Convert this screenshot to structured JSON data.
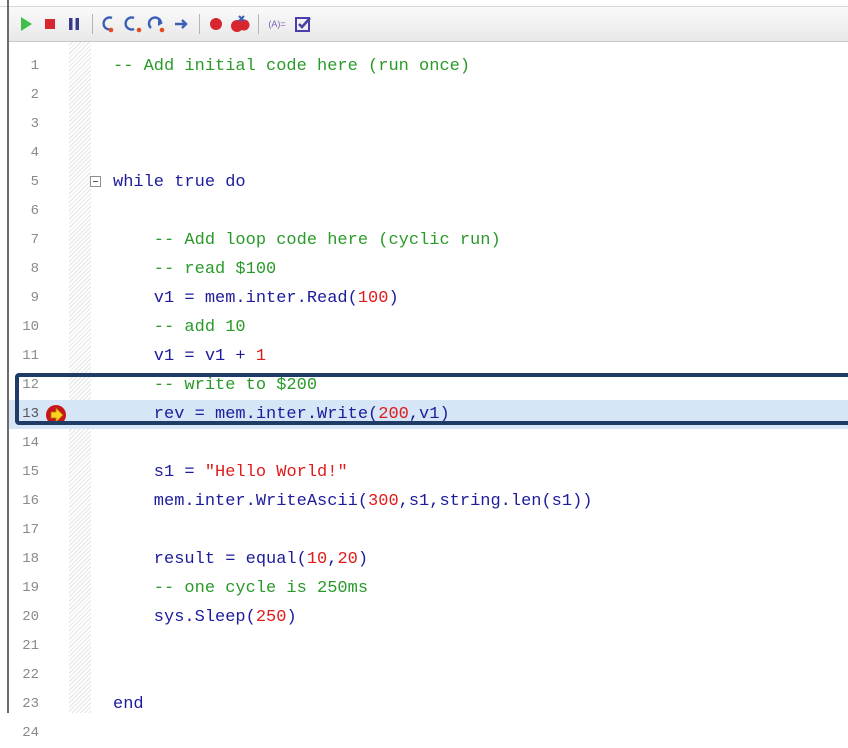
{
  "toolbar": {
    "buttons": [
      {
        "name": "run-button",
        "icon": "play-icon",
        "color": "#3fbf4a"
      },
      {
        "name": "stop-button",
        "icon": "stop-icon",
        "color": "#d7262d"
      },
      {
        "name": "pause-button",
        "icon": "pause-icon",
        "color": "#3a3a8a"
      },
      {
        "name": "step-into-button",
        "icon": "step-into-icon",
        "color": "#e84a1f"
      },
      {
        "name": "step-over-button",
        "icon": "step-over-icon",
        "color": "#3a5fb8"
      },
      {
        "name": "step-out-button",
        "icon": "step-out-icon",
        "color": "#e84a1f"
      },
      {
        "name": "run-to-cursor-button",
        "icon": "arrow-right-icon",
        "color": "#3a5fb8"
      },
      {
        "name": "toggle-breakpoint-button",
        "icon": "breakpoint-icon",
        "color": "#d7262d"
      },
      {
        "name": "clear-breakpoints-button",
        "icon": "clear-breakpoints-icon",
        "color": "#d7262d"
      },
      {
        "name": "watch-button",
        "icon": "watch-variable-icon",
        "color": "#7a5fb0"
      },
      {
        "name": "check-syntax-button",
        "icon": "checkbox-icon",
        "color": "#4a3fa8"
      }
    ],
    "watch_label": "(A)="
  },
  "editor": {
    "current_line": 13,
    "lines": [
      {
        "n": "1",
        "tokens": [
          {
            "t": "-- Add initial code here (run once)",
            "c": "cm"
          }
        ]
      },
      {
        "n": "2",
        "tokens": []
      },
      {
        "n": "3",
        "tokens": []
      },
      {
        "n": "4",
        "tokens": []
      },
      {
        "n": "5",
        "fold": true,
        "tokens": [
          {
            "t": "while true do",
            "c": "kw"
          }
        ]
      },
      {
        "n": "6",
        "tokens": []
      },
      {
        "n": "7",
        "tokens": [
          {
            "t": "    -- Add loop code here (cyclic run)",
            "c": "cm"
          }
        ]
      },
      {
        "n": "8",
        "tokens": [
          {
            "t": "    -- read $100",
            "c": "cm"
          }
        ]
      },
      {
        "n": "9",
        "tokens": [
          {
            "t": "    v1 = mem.inter.Read(",
            "c": "kw"
          },
          {
            "t": "100",
            "c": "nm"
          },
          {
            "t": ")",
            "c": "kw"
          }
        ]
      },
      {
        "n": "10",
        "tokens": [
          {
            "t": "    -- add 10",
            "c": "cm"
          }
        ]
      },
      {
        "n": "11",
        "tokens": [
          {
            "t": "    v1 = v1 + ",
            "c": "kw"
          },
          {
            "t": "1",
            "c": "nm"
          }
        ]
      },
      {
        "n": "12",
        "tokens": [
          {
            "t": "    -- write to $200",
            "c": "cm"
          }
        ]
      },
      {
        "n": "13",
        "current": true,
        "tokens": [
          {
            "t": "    rev = mem.inter.Write(",
            "c": "kw"
          },
          {
            "t": "200",
            "c": "nm"
          },
          {
            "t": ",v1)",
            "c": "kw"
          }
        ]
      },
      {
        "n": "14",
        "tokens": []
      },
      {
        "n": "15",
        "tokens": [
          {
            "t": "    s1 = ",
            "c": "kw"
          },
          {
            "t": "\"Hello World!\"",
            "c": "st"
          }
        ]
      },
      {
        "n": "16",
        "tokens": [
          {
            "t": "    mem.inter.WriteAscii(",
            "c": "kw"
          },
          {
            "t": "300",
            "c": "nm"
          },
          {
            "t": ",s1,string.len(s1))",
            "c": "kw"
          }
        ]
      },
      {
        "n": "17",
        "tokens": []
      },
      {
        "n": "18",
        "tokens": [
          {
            "t": "    result = equal(",
            "c": "kw"
          },
          {
            "t": "10",
            "c": "nm"
          },
          {
            "t": ",",
            "c": "kw"
          },
          {
            "t": "20",
            "c": "nm"
          },
          {
            "t": ")",
            "c": "kw"
          }
        ]
      },
      {
        "n": "19",
        "tokens": [
          {
            "t": "    -- one cycle is 250ms",
            "c": "cm"
          }
        ]
      },
      {
        "n": "20",
        "tokens": [
          {
            "t": "    sys.Sleep(",
            "c": "kw"
          },
          {
            "t": "250",
            "c": "nm"
          },
          {
            "t": ")",
            "c": "kw"
          }
        ]
      },
      {
        "n": "21",
        "tokens": []
      },
      {
        "n": "22",
        "tokens": []
      },
      {
        "n": "23",
        "tokens": [
          {
            "t": "end",
            "c": "kw"
          }
        ]
      },
      {
        "n": "24",
        "tokens": []
      }
    ]
  }
}
